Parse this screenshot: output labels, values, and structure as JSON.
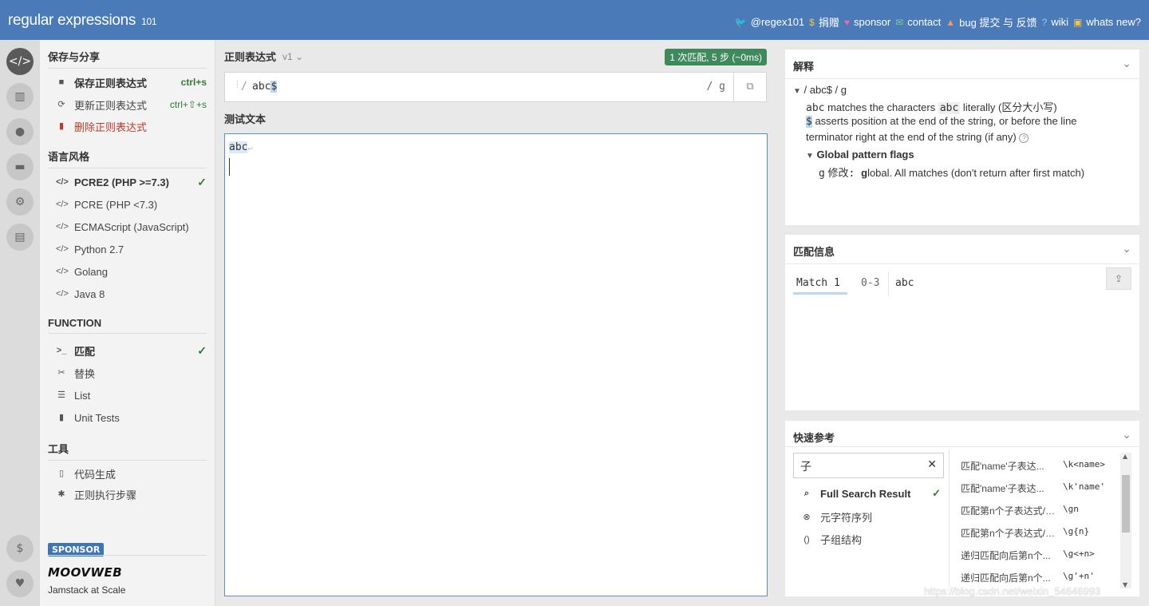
{
  "topbar": {
    "logo": "regular expressions",
    "logo_ver": "101",
    "nav": [
      {
        "icon": "twitter-icon",
        "glyph": "🐦",
        "label": "@regex101",
        "color": "#7fb8f0"
      },
      {
        "icon": "dollar-icon",
        "glyph": "$",
        "label": "捐赠",
        "color": "#f4c542"
      },
      {
        "icon": "heart-icon",
        "glyph": "♥",
        "label": "sponsor",
        "color": "#e86aa6"
      },
      {
        "icon": "mail-icon",
        "glyph": "✉",
        "label": "contact",
        "color": "#7ed087"
      },
      {
        "icon": "warning-icon",
        "glyph": "▲",
        "label": "bug 提交 与 反馈",
        "color": "#f09a5a"
      },
      {
        "icon": "book-icon",
        "glyph": "?",
        "label": "wiki",
        "color": "#8fd0f2"
      },
      {
        "icon": "gift-icon",
        "glyph": "▣",
        "label": "whats new?",
        "color": "#f4c542"
      }
    ]
  },
  "sidebar_icons": [
    "code-icon",
    "library-icon",
    "user-icon",
    "gamepad-icon",
    "settings-icon",
    "chat-icon",
    "dollar-icon",
    "heart-icon"
  ],
  "left": {
    "save_share": {
      "title": "保存与分享",
      "save": {
        "label": "保存正则表达式",
        "shortcut": "ctrl+s"
      },
      "update": {
        "label": "更新正则表达式",
        "shortcut": "ctrl+⇧+s"
      },
      "delete": {
        "label": "删除正则表达式"
      }
    },
    "flavor": {
      "title": "语言风格",
      "items": [
        "PCRE2 (PHP >=7.3)",
        "PCRE (PHP <7.3)",
        "ECMAScript (JavaScript)",
        "Python 2.7",
        "Golang",
        "Java 8"
      ],
      "selected": "✓"
    },
    "function": {
      "title": "FUNCTION",
      "items": [
        "匹配",
        "替换",
        "List",
        "Unit Tests"
      ],
      "selected": "✓"
    },
    "tools": {
      "title": "工具",
      "items": [
        "代码生成",
        "正则执行步骤"
      ]
    },
    "sponsor": {
      "badge": "SPONSOR",
      "brand": "MOOVWEB",
      "tagline": "Jamstack at Scale"
    }
  },
  "center": {
    "regex_title": "正则表达式",
    "regex_version": "v1",
    "match_badge": "1 次匹配, 5 步 (~0ms)",
    "regex_delim": "/",
    "regex_body": "abc",
    "regex_end": "$",
    "regex_flags": "/ g",
    "test_title": "测试文本",
    "test_match": "abc",
    "test_newline": "↵"
  },
  "explanation": {
    "title": "解释",
    "root": "/ abc$ / g",
    "line1_code": "abc",
    "line1_mid": " matches the characters ",
    "line1_code2": "abc",
    "line1_end": " literally (区分大小写)",
    "line2_code": "$",
    "line2_text": " asserts position at the end of the string, or before the line",
    "line3_text": "terminator right at the end of the string (if any)",
    "help": "?",
    "flags_title": "Global pattern flags",
    "flag_g": "g",
    "flag_desc_pre": "修改: ",
    "flag_desc_bold": "g",
    "flag_desc_rest": "lobal. All matches (don't return after first match)"
  },
  "match_info": {
    "title": "匹配信息",
    "match_label": "Match 1",
    "range": "0-3",
    "value": "abc"
  },
  "quick_ref": {
    "title": "快速参考",
    "search": "子",
    "categories": [
      {
        "icon": "search-icon",
        "glyph": "🔍",
        "label": "Full Search Result",
        "checked": "✓"
      },
      {
        "icon": "metachar-icon",
        "glyph": "⊗",
        "label": "元字符序列"
      },
      {
        "icon": "group-icon",
        "glyph": "()",
        "label": "子组结构"
      }
    ],
    "items": [
      {
        "desc": "匹配'name'子表达...",
        "code": "\\k<name>"
      },
      {
        "desc": "匹配'name'子表达...",
        "code": "\\k'name'"
      },
      {
        "desc": "匹配第n个子表达式/分组...",
        "code": "\\gn"
      },
      {
        "desc": "匹配第n个子表达式/分...",
        "code": "\\g{n}"
      },
      {
        "desc": "递归匹配向后第n个...",
        "code": "\\g<+n>"
      },
      {
        "desc": "递归匹配向后第n个...",
        "code": "\\g'+n'"
      }
    ]
  },
  "watermark": "https://blog.csdn.net/weixin_54646993"
}
